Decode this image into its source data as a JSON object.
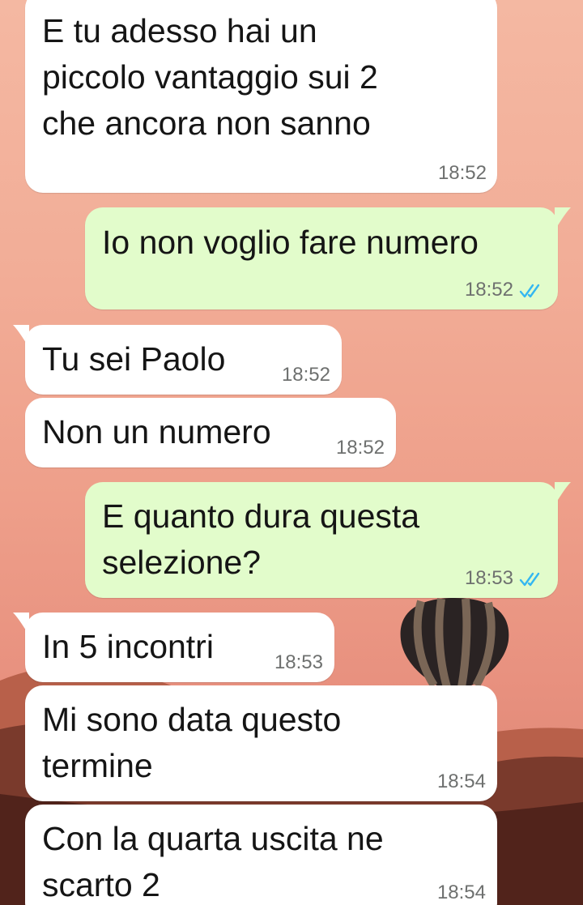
{
  "messages": [
    {
      "direction": "in",
      "text": "E tu adesso hai un\npiccolo vantaggio sui 2\nche ancora non sanno",
      "time": "18:52"
    },
    {
      "direction": "out",
      "text": "Io non voglio fare numero",
      "time": "18:52",
      "status": "read",
      "status_icon": "double-check-icon"
    },
    {
      "direction": "in",
      "text": "Tu sei Paolo",
      "time": "18:52"
    },
    {
      "direction": "in",
      "text": "Non un numero",
      "time": "18:52"
    },
    {
      "direction": "out",
      "text": "E quanto dura questa\nselezione?",
      "time": "18:53",
      "status": "read",
      "status_icon": "double-check-icon"
    },
    {
      "direction": "in",
      "text": "In 5 incontri",
      "time": "18:53"
    },
    {
      "direction": "in",
      "text": "Mi sono data questo\ntermine",
      "time": "18:54"
    },
    {
      "direction": "in",
      "text": "Con la quarta uscita ne\nscarto 2",
      "time": "18:54"
    }
  ],
  "colors": {
    "incoming_bubble": "#ffffff",
    "outgoing_bubble": "#e2fccb",
    "read_tick": "#34b7f1",
    "timestamp": "#6e706f"
  },
  "wallpaper": "hot-air-balloon-sunset"
}
